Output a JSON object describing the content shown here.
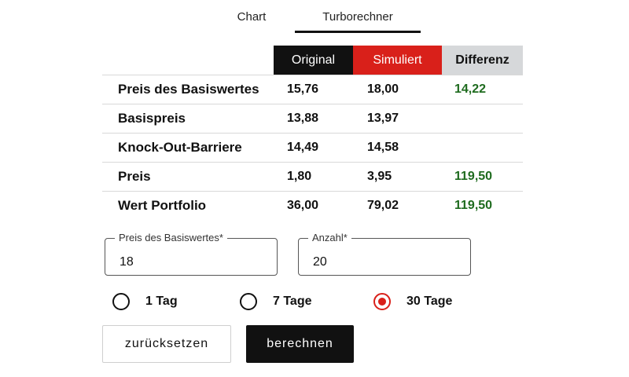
{
  "tabs": [
    {
      "label": "Chart"
    },
    {
      "label": "Turborechner",
      "active": true
    }
  ],
  "table": {
    "headers": {
      "original": "Original",
      "simuliert": "Simuliert",
      "differenz": "Differenz"
    },
    "rows": [
      {
        "label": "Preis des Basiswertes",
        "original": "15,76",
        "simuliert": "18,00",
        "differenz": "14,22"
      },
      {
        "label": "Basispreis",
        "original": "13,88",
        "simuliert": "13,97",
        "differenz": ""
      },
      {
        "label": "Knock-Out-Barriere",
        "original": "14,49",
        "simuliert": "14,58",
        "differenz": ""
      },
      {
        "label": "Preis",
        "original": "1,80",
        "simuliert": "3,95",
        "differenz": "119,50"
      },
      {
        "label": "Wert Portfolio",
        "original": "36,00",
        "simuliert": "79,02",
        "differenz": "119,50"
      }
    ]
  },
  "inputs": {
    "basiswert": {
      "label": "Preis des Basiswertes*",
      "value": "18"
    },
    "anzahl": {
      "label": "Anzahl*",
      "value": "20"
    }
  },
  "radios": [
    {
      "label": "1 Tag",
      "selected": false
    },
    {
      "label": "7 Tage",
      "selected": false
    },
    {
      "label": "30 Tage",
      "selected": true
    }
  ],
  "buttons": {
    "reset": "zurücksetzen",
    "calc": "berechnen"
  },
  "colors": {
    "accent": "#d9201a",
    "positive": "#1e6b1e",
    "dark": "#111111"
  }
}
